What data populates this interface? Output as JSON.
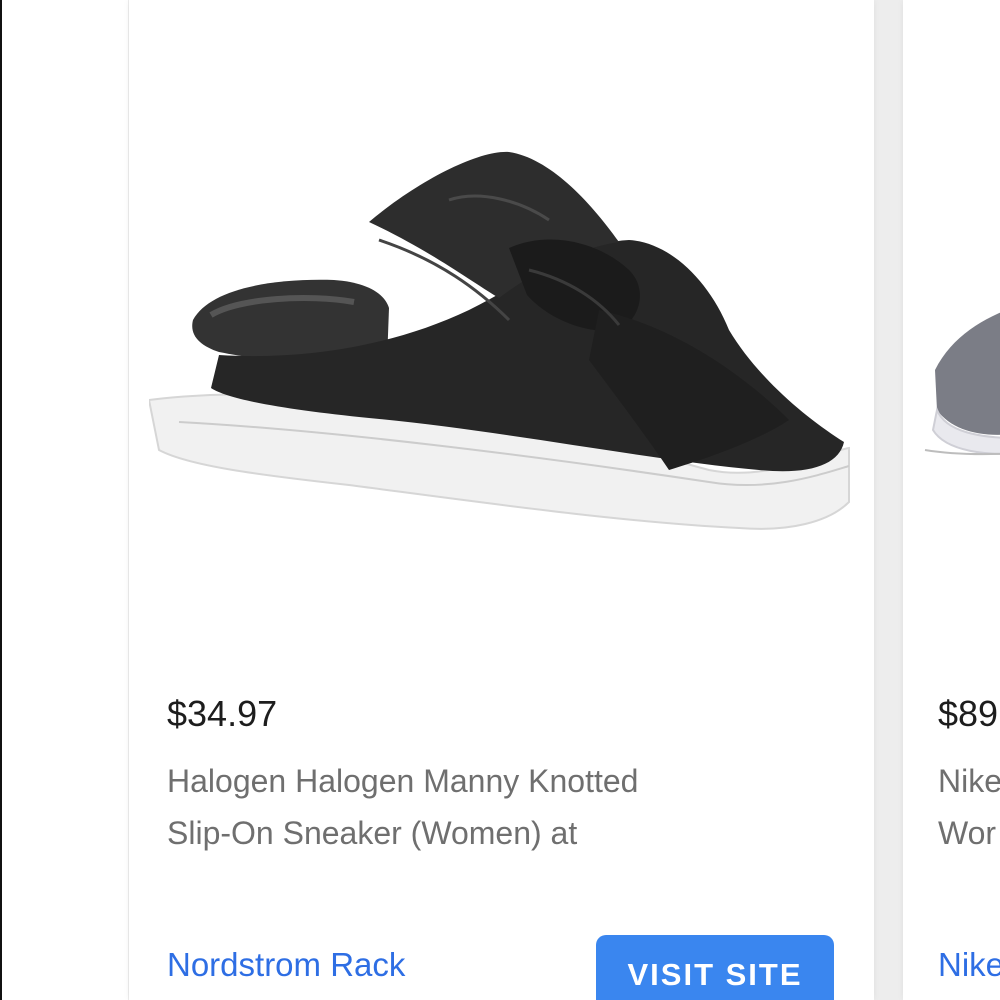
{
  "cards": [
    {
      "price": "$34.97",
      "title_line1": "Halogen Halogen Manny Knotted",
      "title_line2": "Slip-On Sneaker (Women) at",
      "store": "Nordstrom Rack",
      "button_label": "VISIT SITE",
      "image": "black-knotted-leather-slip-on-sneaker"
    },
    {
      "price": "$89",
      "title_line1": "Nike",
      "title_line2": "Wor",
      "store": "Nike",
      "image": "gray-knit-sneaker"
    }
  ],
  "colors": {
    "link": "#2e6ee4",
    "button": "#3a86ef",
    "price": "#1d1d1d",
    "title": "#6f6f6f"
  }
}
